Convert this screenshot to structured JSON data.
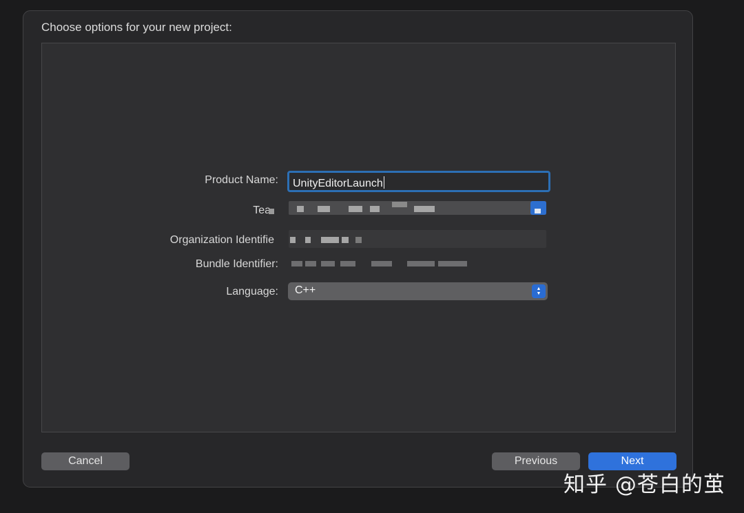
{
  "dialog": {
    "title": "Choose options for your new project:"
  },
  "form": {
    "product_name_label": "Product Name:",
    "product_name_value": "UnityEditorLaunch",
    "team_label": "Tea",
    "organization_identifier_label": "Organization Identifie",
    "bundle_identifier_label": "Bundle Identifier:",
    "language_label": "Language:",
    "language_value": "C++"
  },
  "buttons": {
    "cancel": "Cancel",
    "previous": "Previous",
    "next": "Next"
  },
  "watermark": {
    "text": "知乎 @苍白的茧"
  },
  "colors": {
    "accent": "#2f72dc",
    "focus_ring": "#2c6fb5",
    "background": "#1b1b1c"
  },
  "icons": {
    "select_stepper": "up-down-chevron-icon"
  }
}
